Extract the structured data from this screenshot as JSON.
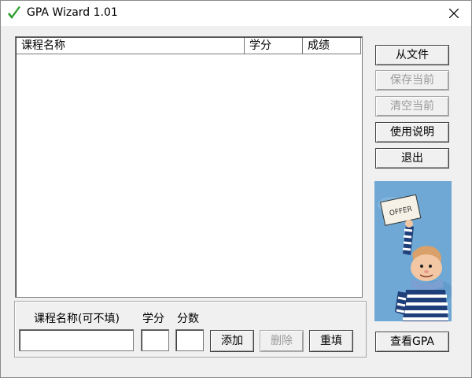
{
  "window": {
    "title": "GPA Wizard 1.01"
  },
  "table": {
    "columns": [
      "课程名称",
      "学分",
      "成绩"
    ],
    "rows": []
  },
  "sidebar": {
    "from_file": "从文件",
    "save_current": "保存当前",
    "clear_current": "清空当前",
    "instructions": "使用说明",
    "exit": "退出",
    "view_gpa": "查看GPA",
    "picture_sign_text": "OFFER"
  },
  "form": {
    "course_name_label": "课程名称(可不填)",
    "credit_label": "学分",
    "score_label": "分数",
    "course_name_value": "",
    "credit_value": "",
    "score_value": "",
    "add": "添加",
    "delete": "删除",
    "reset": "重填"
  },
  "colors": {
    "title_icon": "#2e9e2e",
    "picture_bg": "#6fa8d4",
    "disabled_text": "#9a9a9a"
  }
}
